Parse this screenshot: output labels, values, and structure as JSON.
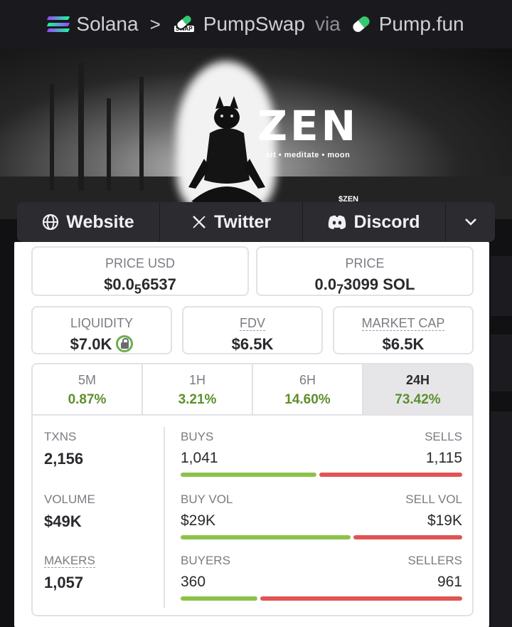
{
  "breadcrumb": {
    "chain": "Solana",
    "dex": "PumpSwap",
    "dex_icon_badge": "SWAP",
    "via": "via",
    "launchpad": "Pump.fun",
    "separator": ">"
  },
  "banner": {
    "logo_text": "ZEN",
    "tagline": "sit • meditate • moon",
    "ticker_partial": "$ZEN"
  },
  "social": {
    "website": "Website",
    "twitter": "Twitter",
    "discord": "Discord"
  },
  "prices": {
    "price_usd_label": "PRICE USD",
    "price_usd_prefix": "$0.0",
    "price_usd_zeros": "5",
    "price_usd_digits": "6537",
    "price_label": "PRICE",
    "price_prefix": "0.0",
    "price_zeros": "7",
    "price_digits": "3099 SOL"
  },
  "metrics": {
    "liquidity_label": "LIQUIDITY",
    "liquidity_value": "$7.0K",
    "fdv_label": "FDV",
    "fdv_value": "$6.5K",
    "mcap_label": "MARKET CAP",
    "mcap_value": "$6.5K"
  },
  "periods": [
    {
      "label": "5M",
      "change": "0.87%"
    },
    {
      "label": "1H",
      "change": "3.21%"
    },
    {
      "label": "6H",
      "change": "14.60%"
    },
    {
      "label": "24H",
      "change": "73.42%",
      "active": true
    }
  ],
  "stats": {
    "txns_label": "TXNS",
    "txns_value": "2,156",
    "volume_label": "VOLUME",
    "volume_value": "$49K",
    "makers_label": "MAKERS",
    "makers_value": "1,057",
    "buys_label": "BUYS",
    "buys_value": "1,041",
    "buys_fraction": 0.483,
    "sells_label": "SELLS",
    "sells_value": "1,115",
    "buy_vol_label": "BUY VOL",
    "buy_vol_value": "$29K",
    "buy_vol_fraction": 0.604,
    "sell_vol_label": "SELL VOL",
    "sell_vol_value": "$19K",
    "buyers_label": "BUYERS",
    "buyers_value": "360",
    "buyers_fraction": 0.273,
    "sellers_label": "SELLERS",
    "sellers_value": "961"
  },
  "colors": {
    "positive": "#5e8f2d",
    "buy_bar": "#8bc34a",
    "sell_bar": "#e15454",
    "lock_ring": "#6ab04c"
  }
}
